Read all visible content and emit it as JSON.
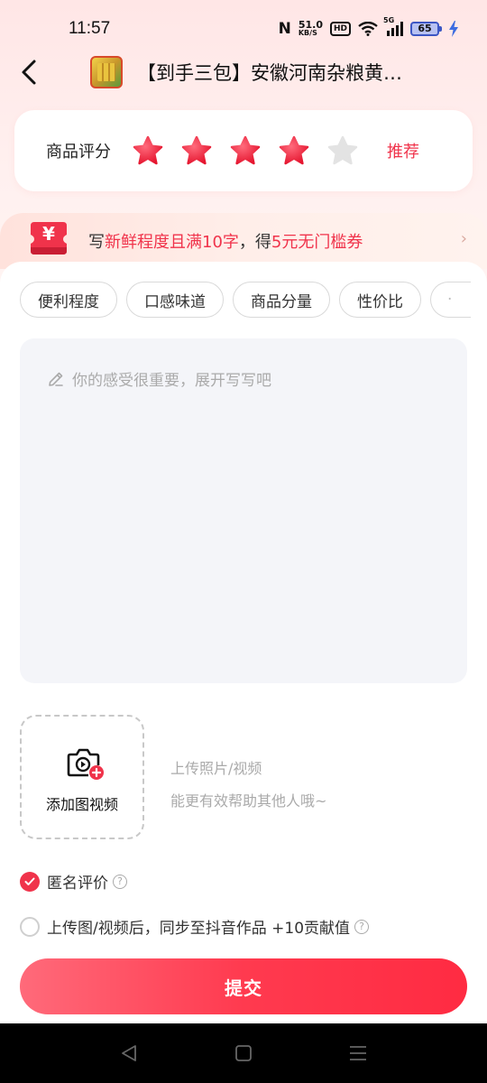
{
  "status_bar": {
    "time": "11:57",
    "nfc": "N",
    "speed_value": "51.0",
    "speed_unit": "KB/S",
    "hd_badge": "HD",
    "network": "5G",
    "battery": "65"
  },
  "header": {
    "product_title": "【到手三包】安徽河南杂粮黄…"
  },
  "rating": {
    "label": "商品评分",
    "stars_filled": 4,
    "stars_total": 5,
    "text": "推荐",
    "colors": {
      "active": "#f0334b",
      "inactive": "#e0e0e0"
    }
  },
  "promo": {
    "icon": "coupon-yuan-icon",
    "icon_symbol": "¥",
    "prefix": "写",
    "highlight1": "新鲜程度且满10字",
    "middle": "，得",
    "highlight2": "5元无门槛券"
  },
  "tags": [
    "便利程度",
    "口感味道",
    "商品分量",
    "性价比",
    "·"
  ],
  "review_input": {
    "placeholder": "你的感受很重要，展开写写吧"
  },
  "upload": {
    "label": "添加图视频",
    "hint_line1": "上传照片/视频",
    "hint_line2": "能更有效帮助其他人哦~"
  },
  "options": {
    "anonymous": {
      "label": "匿名评价",
      "checked": true
    },
    "sync": {
      "label": "上传图/视频后，同步至抖音作品 +10贡献值",
      "checked": false
    }
  },
  "submit_label": "提交",
  "accent_color": "#f0334b"
}
